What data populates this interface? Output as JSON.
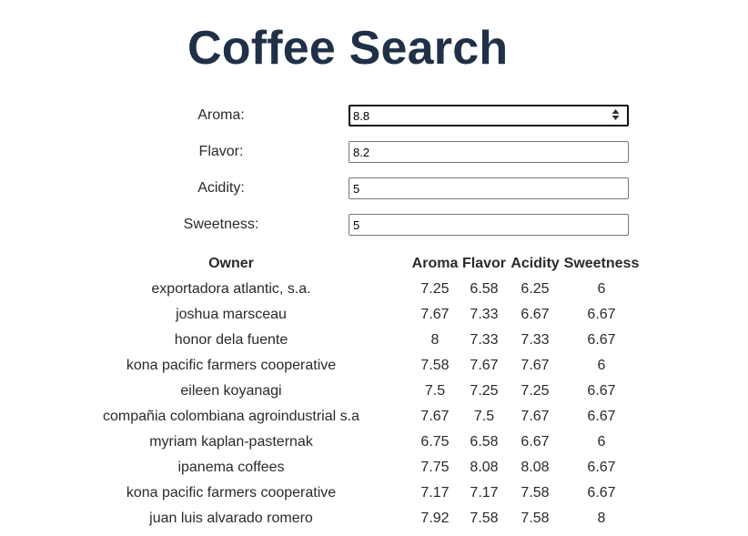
{
  "page": {
    "title": "Coffee Search"
  },
  "form": {
    "fields": [
      {
        "label": "Aroma:",
        "value": "8.8"
      },
      {
        "label": "Flavor:",
        "value": "8.2"
      },
      {
        "label": "Acidity:",
        "value": "5"
      },
      {
        "label": "Sweetness:",
        "value": "5"
      }
    ]
  },
  "table": {
    "headers": [
      "Owner",
      "Aroma",
      "Flavor",
      "Acidity",
      "Sweetness"
    ],
    "rows": [
      [
        "exportadora atlantic, s.a.",
        "7.25",
        "6.58",
        "6.25",
        "6"
      ],
      [
        "joshua marsceau",
        "7.67",
        "7.33",
        "6.67",
        "6.67"
      ],
      [
        "honor dela fuente",
        "8",
        "7.33",
        "7.33",
        "6.67"
      ],
      [
        "kona pacific farmers cooperative",
        "7.58",
        "7.67",
        "7.67",
        "6"
      ],
      [
        "eileen koyanagi",
        "7.5",
        "7.25",
        "7.25",
        "6.67"
      ],
      [
        "compañia colombiana agroindustrial s.a",
        "7.67",
        "7.5",
        "7.67",
        "6.67"
      ],
      [
        "myriam kaplan-pasternak",
        "6.75",
        "6.58",
        "6.67",
        "6"
      ],
      [
        "ipanema coffees",
        "7.75",
        "8.08",
        "8.08",
        "6.67"
      ],
      [
        "kona pacific farmers cooperative",
        "7.17",
        "7.17",
        "7.58",
        "6.67"
      ],
      [
        "juan luis alvarado romero",
        "7.92",
        "7.58",
        "7.58",
        "8"
      ]
    ]
  }
}
